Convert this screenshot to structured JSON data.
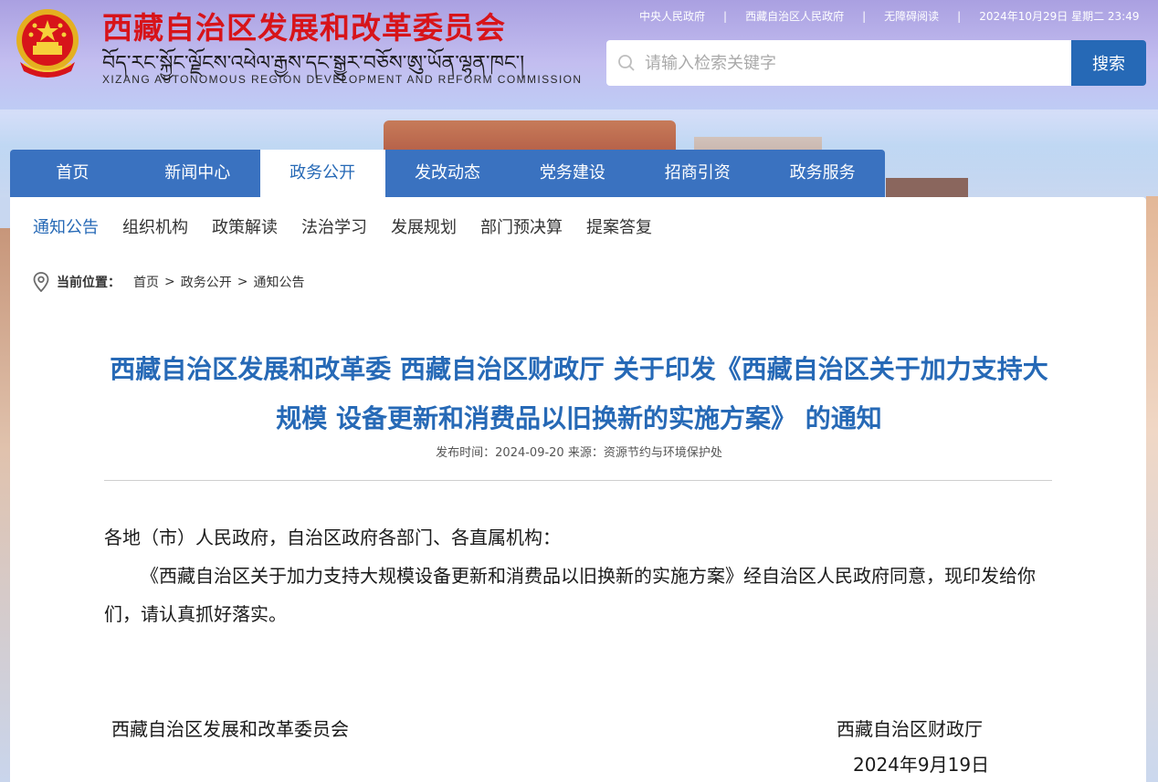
{
  "header": {
    "site_title": "西藏自治区发展和改革委员会",
    "site_tibetan": "བོད་རང་སྐྱོང་ལྗོངས་འཕེལ་རྒྱས་དང་སྒྱུར་བཅོས་ཨུ་ཡོན་ལྷན་ཁང་།",
    "site_english": "XIZANG AUTONOMOUS REGION DEVELOPMENT AND REFORM COMMISSION",
    "emblem_icon": "national-emblem-icon",
    "top_links": [
      "中央人民政府",
      "西藏自治区人民政府",
      "无障碍阅读"
    ],
    "separator": "|",
    "datetime": "2024年10月29日 星期二 23:49"
  },
  "search": {
    "placeholder": "请输入检索关键字",
    "value": "",
    "button_label": "搜索",
    "icon": "search-icon"
  },
  "main_nav": {
    "items": [
      "首页",
      "新闻中心",
      "政务公开",
      "发改动态",
      "党务建设",
      "招商引资",
      "政务服务"
    ],
    "active": "政务公开"
  },
  "sub_nav": {
    "items": [
      "通知公告",
      "组织机构",
      "政策解读",
      "法治学习",
      "发展规划",
      "部门预决算",
      "提案答复"
    ],
    "active": "通知公告"
  },
  "breadcrumb": {
    "label": "当前位置：",
    "items": [
      "首页",
      "政务公开",
      "通知公告"
    ],
    "separator": ">",
    "icon": "location-pin-icon"
  },
  "article": {
    "title": "西藏自治区发展和改革委 西藏自治区财政厅 关于印发《西藏自治区关于加力支持大规模 设备更新和消费品以旧换新的实施方案》 的通知",
    "meta": "发布时间：2024-09-20 来源：资源节约与环境保护处",
    "salutation": "各地（市）人民政府，自治区政府各部门、各直属机构：",
    "paragraph": "《西藏自治区关于加力支持大规模设备更新和消费品以旧换新的实施方案》经自治区人民政府同意，现印发给你们，请认真抓好落实。",
    "signer_left": "西藏自治区发展和改革委员会",
    "signer_right": "西藏自治区财政厅",
    "sign_date": "2024年9月19日"
  },
  "colors": {
    "brand_red": "#d7141a",
    "accent_blue": "#2669b6",
    "nav_blue": "#3a72c0"
  }
}
